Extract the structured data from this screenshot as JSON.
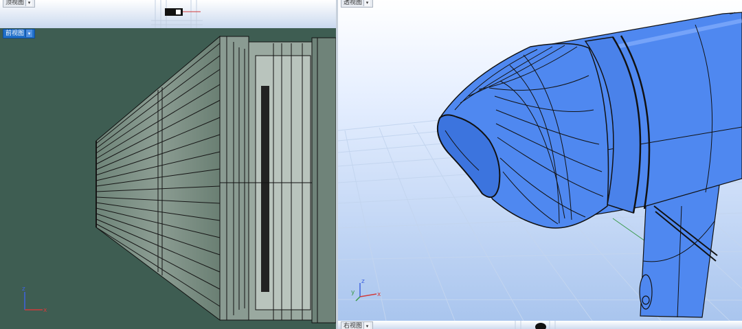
{
  "viewports": {
    "top": {
      "label": "顶视图"
    },
    "front": {
      "label": "前视图"
    },
    "perspective": {
      "label": "透视图"
    },
    "right": {
      "label": "右视图"
    }
  },
  "dropdown_arrow": "▾",
  "axes": {
    "x": "x",
    "y": "y",
    "z": "z"
  },
  "colors": {
    "front_bg": "#3e5d52",
    "persp_bg_top": "#ffffff",
    "persp_bg_bottom": "#a9c5ee",
    "model_blue": "#4f88f0",
    "active_label": "#1f6fc9"
  }
}
